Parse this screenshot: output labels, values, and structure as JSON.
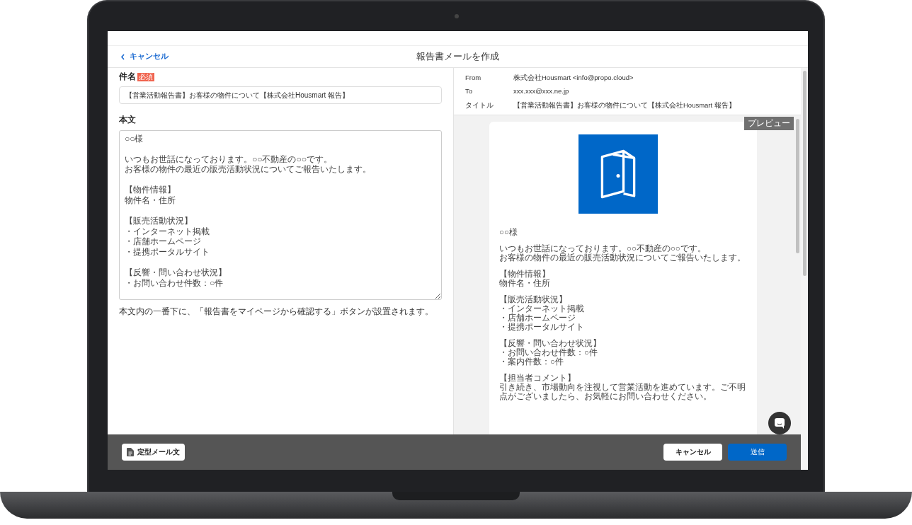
{
  "header": {
    "back_link": "キャンセル",
    "title": "報告書メールを作成"
  },
  "form": {
    "subject": {
      "label": "件名",
      "required_badge": "必須",
      "value": "【営業活動報告書】お客様の物件について【株式会社Housmart 報告】"
    },
    "body": {
      "label": "本文",
      "paragraphs": [
        [
          "○○様"
        ],
        [
          "いつもお世話になっております。○○不動産の○○です。",
          "お客様の物件の最近の販売活動状況についてご報告いたします。"
        ],
        [
          "【物件情報】",
          "物件名・住所"
        ],
        [
          "【販売活動状況】",
          "・インターネット掲載",
          "・店舗ホームページ",
          "・提携ポータルサイト"
        ],
        [
          "【反響・問い合わせ状況】",
          "・お問い合わせ件数：○件"
        ]
      ],
      "note": "本文内の一番下に、「報告書をマイページから確認する」ボタンが設置されます。"
    }
  },
  "preview": {
    "meta": [
      {
        "label": "From",
        "value": "株式会社Housmart <info@propo.cloud>"
      },
      {
        "label": "To",
        "value": "xxx.xxx@xxx.ne.jp"
      },
      {
        "label": "タイトル",
        "value": "【営業活動報告書】お客様の物件について【株式会社Housmart 報告】"
      }
    ],
    "badge": "プレビュー",
    "paragraphs": [
      [
        "○○様"
      ],
      [
        "いつもお世話になっております。○○不動産の○○です。",
        "お客様の物件の最近の販売活動状況についてご報告いたします。"
      ],
      [
        "【物件情報】",
        "物件名・住所"
      ],
      [
        "【販売活動状況】",
        "・インターネット掲載",
        "・店舗ホームページ",
        "・提携ポータルサイト"
      ],
      [
        "【反響・問い合わせ状況】",
        "・お問い合わせ件数：○件",
        "・案内件数：○件"
      ],
      [
        "【担当者コメント】",
        "引き続き、市場動向を注視して営業活動を進めています。ご不明点がございましたら、お気軽にお問い合わせください。"
      ]
    ]
  },
  "footer": {
    "template_button": "定型メール文",
    "buttons": [
      {
        "label": "キャンセル",
        "kind": "secondary"
      },
      {
        "label": "送信",
        "kind": "primary"
      }
    ]
  }
}
